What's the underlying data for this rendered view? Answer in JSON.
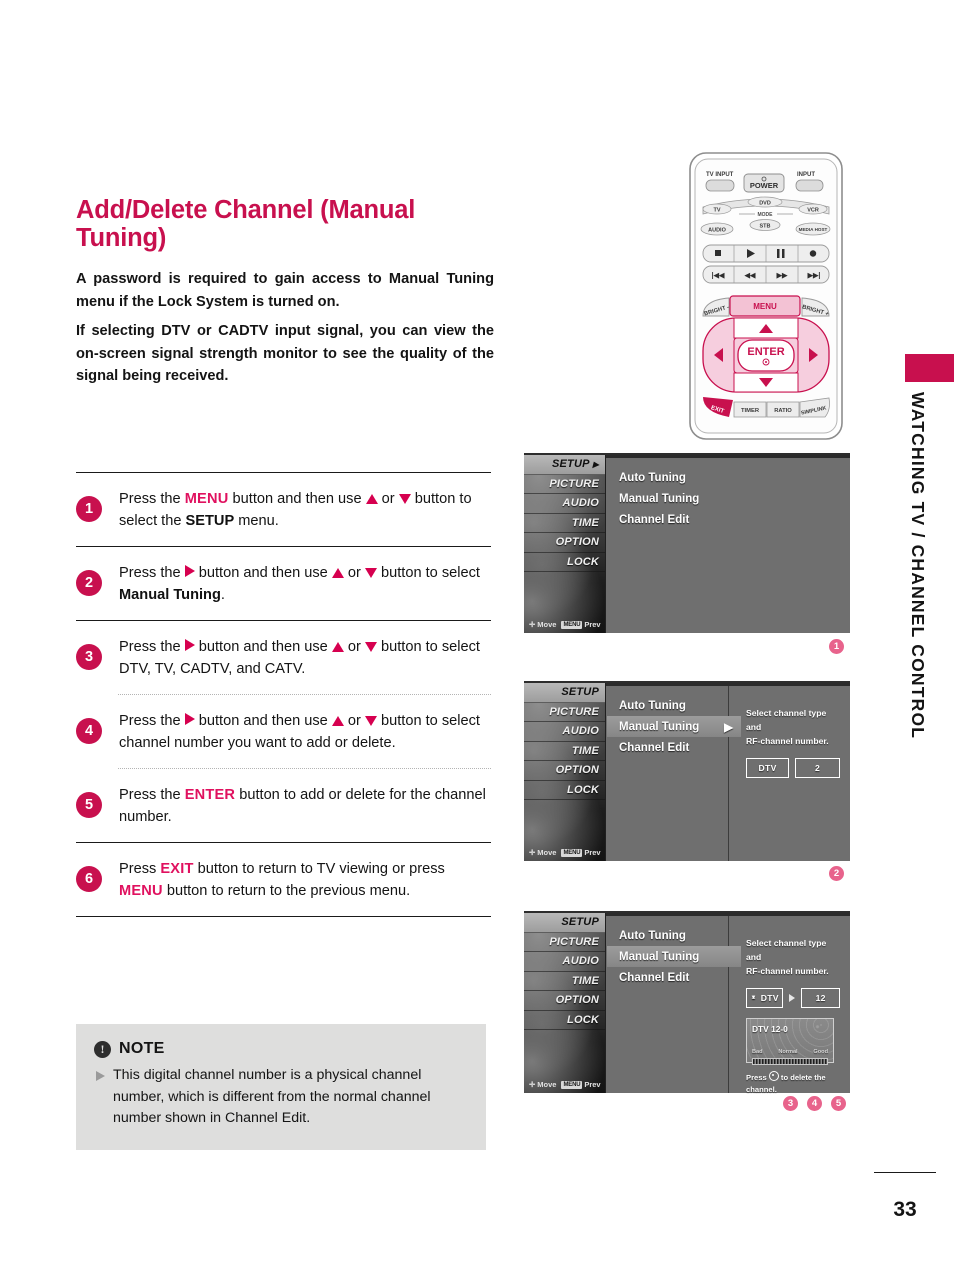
{
  "colors": {
    "accent": "#C8104E",
    "keyword": "#E0115F",
    "callout": "#E8638C",
    "note_bg": "#dededd"
  },
  "document": {
    "title": "Add/Delete Channel (Manual Tuning)",
    "page_number": "33",
    "section_label": "WATCHING TV / CHANNEL CONTROL",
    "intro_paragraphs": [
      "A password is required to gain access to Manual Tuning menu if the Lock System is turned on.",
      "If selecting DTV or CADTV input signal, you can view the on-screen signal strength monitor to see the quality of the signal being received."
    ]
  },
  "steps": [
    {
      "num": "1",
      "before": "Press the ",
      "kw1": "MENU",
      "mid1": " button and then use ",
      "mid2": " or ",
      "mid3": " button to select the ",
      "bold": "SETUP",
      "after": " menu."
    },
    {
      "num": "2",
      "before": "Press the ",
      "mid1": " button and then use ",
      "mid2": " or ",
      "mid3": " button to select ",
      "bold": "Manual Tuning",
      "after": "."
    },
    {
      "num": "3",
      "before": "Press the ",
      "mid1": " button and then use ",
      "mid2": " or ",
      "mid3": " button to select DTV, TV, CADTV, and CATV."
    },
    {
      "num": "4",
      "before": "Press the ",
      "mid1": " button and then use ",
      "mid2": " or ",
      "mid3": " button to select channel number you want to add or delete."
    },
    {
      "num": "5",
      "before": "Press the ",
      "kw1": "ENTER",
      "after": " button to add or delete for the channel number."
    },
    {
      "num": "6",
      "before": "Press ",
      "kw1": "EXIT",
      "mid1": " button to return to TV viewing or press ",
      "kw2": "MENU",
      "after": " button to return to the previous menu."
    }
  ],
  "note": {
    "title": "NOTE",
    "bang": "!",
    "body": "This digital channel number is a physical channel number, which is different from the normal channel number shown in Channel Edit."
  },
  "remote": {
    "buttons": {
      "tv_input": "TV INPUT",
      "power": "POWER",
      "input": "INPUT",
      "tv": "TV",
      "dvd": "DVD",
      "vcr": "VCR",
      "mode": "MODE",
      "audio": "AUDIO",
      "stb": "STB",
      "media_host": "MEDIA HOST",
      "bright_minus": "BRIGHT -",
      "menu": "MENU",
      "bright_plus": "BRIGHT +",
      "enter": "ENTER",
      "exit": "EXIT",
      "timer": "TIMER",
      "ratio": "RATIO",
      "simplink": "SIMPLINK"
    }
  },
  "osd": {
    "sidebar": [
      "SETUP",
      "PICTURE",
      "AUDIO",
      "TIME",
      "OPTION",
      "LOCK"
    ],
    "footer": {
      "move": "Move",
      "menu_key": "MENU",
      "prev": "Prev"
    },
    "menu_items": [
      "Auto Tuning",
      "Manual Tuning",
      "Channel Edit"
    ],
    "hint_line1": "Select channel type and",
    "hint_line2": "RF-channel number.",
    "screen1": {
      "selected_sidebar": "SETUP"
    },
    "screen2": {
      "highlight": "Manual Tuning",
      "channel_type": "DTV",
      "channel_number": "2"
    },
    "screen3": {
      "highlight": "Manual Tuning",
      "channel_type": "DTV",
      "channel_number": "12",
      "signal_title": "DTV 12-0",
      "signal_bad": "Bad",
      "signal_normal": "Normal",
      "signal_good": "Good",
      "delete_hint_before": "Press ",
      "delete_hint_after": " to delete the channel."
    }
  },
  "callouts": {
    "c1": "1",
    "c2": "2",
    "c3": "3",
    "c4": "4",
    "c5": "5"
  }
}
